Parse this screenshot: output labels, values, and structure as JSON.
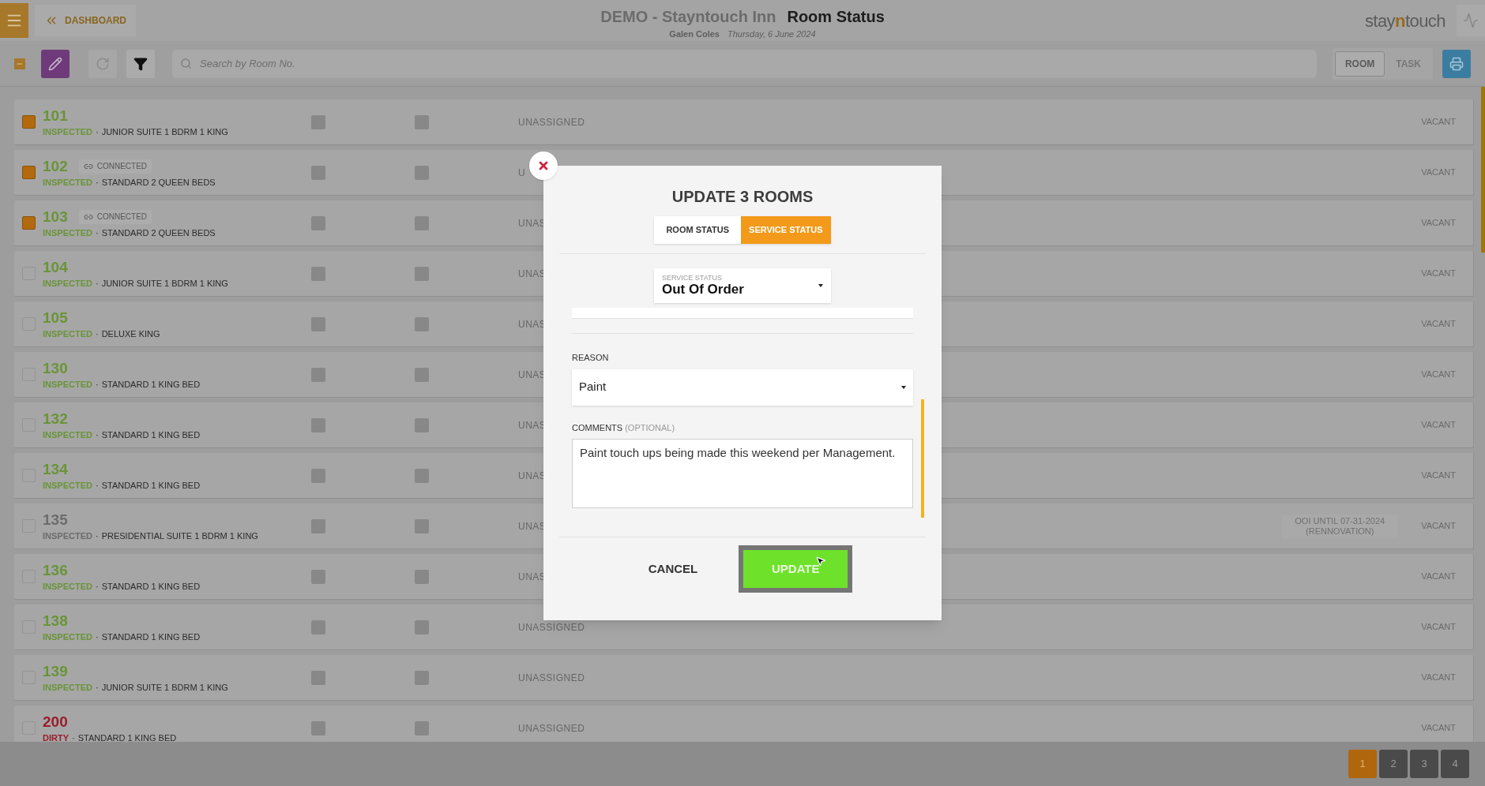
{
  "header": {
    "back_button": "DASHBOARD",
    "hotel": "DEMO - Stayntouch Inn",
    "page_title": "Room Status",
    "user": "Galen Coles",
    "date": "Thursday, 6 June 2024",
    "logo": {
      "before": "stay",
      "accent": "n",
      "after": "touch"
    }
  },
  "toolbar": {
    "search": {
      "placeholder": "Search by Room No."
    },
    "view_toggle": [
      {
        "label": "ROOM",
        "selected": true
      },
      {
        "label": "TASK",
        "selected": false
      }
    ]
  },
  "status_separator": "·",
  "rooms": [
    {
      "number": "101",
      "status": "INSPECTED",
      "type": "JUNIOR SUITE 1 BDRM 1 KING",
      "color": "#6a9438",
      "checked": true,
      "assignment": "UNASSIGNED",
      "occupancy": "VACANT"
    },
    {
      "number": "102",
      "badge": "CONNECTED",
      "status": "INSPECTED",
      "type": "STANDARD 2 QUEEN BEDS",
      "color": "#6a9438",
      "checked": true,
      "assignment": "U",
      "occupancy": "VACANT"
    },
    {
      "number": "103",
      "badge": "CONNECTED",
      "status": "INSPECTED",
      "type": "STANDARD 2 QUEEN BEDS",
      "color": "#6a9438",
      "checked": true,
      "assignment": "UNAS",
      "occupancy": "VACANT"
    },
    {
      "number": "104",
      "status": "INSPECTED",
      "type": "JUNIOR SUITE 1 BDRM 1 KING",
      "color": "#6a9438",
      "checked": false,
      "assignment": "UNAS",
      "occupancy": "VACANT"
    },
    {
      "number": "105",
      "status": "INSPECTED",
      "type": "DELUXE KING",
      "color": "#6a9438",
      "checked": false,
      "assignment": "UNAS",
      "occupancy": "VACANT"
    },
    {
      "number": "130",
      "status": "INSPECTED",
      "type": "STANDARD 1 KING BED",
      "color": "#6a9438",
      "checked": false,
      "assignment": "UNAS",
      "occupancy": "VACANT"
    },
    {
      "number": "132",
      "status": "INSPECTED",
      "type": "STANDARD 1 KING BED",
      "color": "#6a9438",
      "checked": false,
      "assignment": "UNAS",
      "occupancy": "VACANT"
    },
    {
      "number": "134",
      "status": "INSPECTED",
      "type": "STANDARD 1 KING BED",
      "color": "#6a9438",
      "checked": false,
      "assignment": "UNAS",
      "occupancy": "VACANT"
    },
    {
      "number": "135",
      "status": "INSPECTED",
      "type": "PRESIDENTIAL SUITE 1 BDRM 1 KING",
      "color": "#6c6c6c",
      "checked": false,
      "assignment": "UNAS",
      "note": [
        "OOI UNTIL 07-31-2024",
        "(RENNOVATION)"
      ],
      "occupancy": "VACANT"
    },
    {
      "number": "136",
      "status": "INSPECTED",
      "type": "STANDARD 1 KING BED",
      "color": "#6a9438",
      "checked": false,
      "assignment": "UNAS",
      "occupancy": "VACANT"
    },
    {
      "number": "138",
      "status": "INSPECTED",
      "type": "STANDARD 1 KING BED",
      "color": "#6a9438",
      "checked": false,
      "assignment": "UNASSIGNED",
      "occupancy": "VACANT"
    },
    {
      "number": "139",
      "status": "INSPECTED",
      "type": "JUNIOR SUITE 1 BDRM 1 KING",
      "color": "#6a9438",
      "checked": false,
      "assignment": "UNASSIGNED",
      "occupancy": "VACANT"
    },
    {
      "number": "200",
      "status": "DIRTY",
      "type": "STANDARD 1 KING BED",
      "color": "#9a1d2c",
      "checked": false,
      "assignment": "UNASSIGNED",
      "occupancy": "VACANT"
    }
  ],
  "pagination": [
    {
      "label": "1",
      "selected": true
    },
    {
      "label": "2",
      "selected": false
    },
    {
      "label": "3",
      "selected": false
    },
    {
      "label": "4",
      "selected": false
    }
  ],
  "dialog": {
    "title": "UPDATE 3 ROOMS",
    "tabs": [
      {
        "label": "ROOM STATUS",
        "selected": false
      },
      {
        "label": "SERVICE STATUS",
        "selected": true
      }
    ],
    "service_status": {
      "label": "SERVICE STATUS",
      "value": "Out Of Order"
    },
    "reason": {
      "label": "REASON",
      "value": "Paint"
    },
    "comments": {
      "label": "COMMENTS",
      "hint": "(OPTIONAL)",
      "value": "Paint touch ups being made this weekend per Management."
    },
    "buttons": {
      "cancel": "CANCEL",
      "update": "UPDATE"
    }
  }
}
